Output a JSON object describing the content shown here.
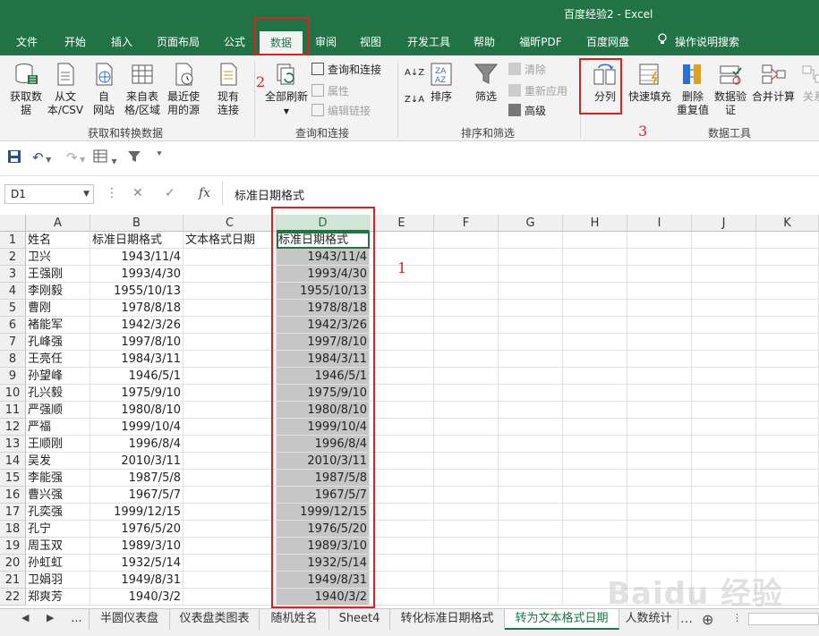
{
  "window": {
    "title": "百度经验2  -  Excel"
  },
  "tabs": [
    "文件",
    "开始",
    "插入",
    "页面布局",
    "公式",
    "数据",
    "审阅",
    "视图",
    "开发工具",
    "帮助",
    "福昕PDF",
    "百度网盘",
    "操作说明搜索"
  ],
  "active_tab": "数据",
  "ribbon": {
    "get_data": "获取数\n据",
    "from_csv": "从文\n本/CSV",
    "from_web": "自\n网站",
    "from_table": "来自表\n格/区域",
    "recent_sources": "最近使\n用的源",
    "existing_conn": "现有\n连接",
    "group1": "获取和转换数据",
    "refresh_all": "全部刷新",
    "queries_conn": "查询和连接",
    "properties": "属性",
    "edit_links": "编辑链接",
    "group2": "查询和连接",
    "sort": "排序",
    "filter": "筛选",
    "clear": "清除",
    "reapply": "重新应用",
    "advanced": "高级",
    "group3": "排序和筛选",
    "text_to_columns": "分列",
    "flash_fill": "快速填充",
    "remove_dup": "删除\n重复值",
    "data_validation": "数据验\n证",
    "consolidate": "合并计算",
    "relationships": "关系",
    "group4": "数据工具"
  },
  "annotations": {
    "a1": "1",
    "a2": "2",
    "a3": "3"
  },
  "namebox": "D1",
  "formula": "标准日期格式",
  "columns": [
    "A",
    "B",
    "C",
    "D",
    "E",
    "F",
    "G",
    "H",
    "I",
    "J",
    "K"
  ],
  "rows": [
    [
      "姓名",
      "标准日期格式",
      "文本格式日期",
      "标准日期格式"
    ],
    [
      "卫兴",
      "1943/11/4",
      "",
      "1943/11/4"
    ],
    [
      "王强刚",
      "1993/4/30",
      "",
      "1993/4/30"
    ],
    [
      "李刚毅",
      "1955/10/13",
      "",
      "1955/10/13"
    ],
    [
      "曹刚",
      "1978/8/18",
      "",
      "1978/8/18"
    ],
    [
      "褚能军",
      "1942/3/26",
      "",
      "1942/3/26"
    ],
    [
      "孔峰强",
      "1997/8/10",
      "",
      "1997/8/10"
    ],
    [
      "王亮任",
      "1984/3/11",
      "",
      "1984/3/11"
    ],
    [
      "孙望峰",
      "1946/5/1",
      "",
      "1946/5/1"
    ],
    [
      "孔兴毅",
      "1975/9/10",
      "",
      "1975/9/10"
    ],
    [
      "严强顺",
      "1980/8/10",
      "",
      "1980/8/10"
    ],
    [
      "严福",
      "1999/10/4",
      "",
      "1999/10/4"
    ],
    [
      "王顺刚",
      "1996/8/4",
      "",
      "1996/8/4"
    ],
    [
      "吴发",
      "2010/3/11",
      "",
      "2010/3/11"
    ],
    [
      "李能强",
      "1987/5/8",
      "",
      "1987/5/8"
    ],
    [
      "曹兴强",
      "1967/5/7",
      "",
      "1967/5/7"
    ],
    [
      "孔奕强",
      "1999/12/15",
      "",
      "1999/12/15"
    ],
    [
      "孔宁",
      "1976/5/20",
      "",
      "1976/5/20"
    ],
    [
      "周玉双",
      "1989/3/10",
      "",
      "1989/3/10"
    ],
    [
      "孙虹虹",
      "1932/5/14",
      "",
      "1932/5/14"
    ],
    [
      "卫娟羽",
      "1949/8/31",
      "",
      "1949/8/31"
    ],
    [
      "郑爽芳",
      "1940/3/2",
      "",
      "1940/3/2"
    ]
  ],
  "sheet_tabs": [
    "...",
    "半圆仪表盘",
    "仪表盘类图表",
    "随机姓名",
    "Sheet4",
    "转化标准日期格式",
    "转为文本格式日期",
    "人数统计"
  ],
  "active_sheet": "转为文本格式日期",
  "watermark": "Baidu 经验",
  "colors": {
    "excel_green": "#217346",
    "highlight_red": "#e02020",
    "selection_gray": "#c6c6c6"
  }
}
